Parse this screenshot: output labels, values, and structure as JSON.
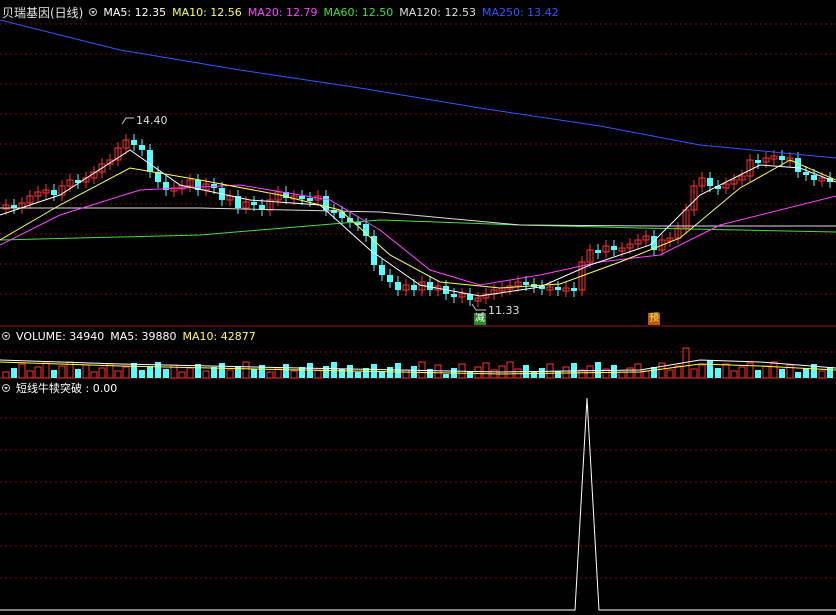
{
  "main_panel": {
    "stock_name": "贝瑞基因(日线)",
    "indicators": [
      {
        "label": "MA5: 12.35",
        "color": "#ffffff"
      },
      {
        "label": "MA10: 12.56",
        "color": "#ffff55"
      },
      {
        "label": "MA20: 12.79",
        "color": "#ff44ff"
      },
      {
        "label": "MA60: 12.50",
        "color": "#44dd44"
      },
      {
        "label": "MA120: 12.53",
        "color": "#dddddd"
      },
      {
        "label": "MA250: 13.42",
        "color": "#3355ff"
      }
    ],
    "annotations": {
      "high": "14.40",
      "low": "11.33"
    },
    "markers": {
      "reduce": "减",
      "forecast": "预"
    }
  },
  "volume_panel": {
    "indicators": [
      {
        "label": "VOLUME: 34940",
        "color": "#ffffff"
      },
      {
        "label": "MA5: 39880",
        "color": "#ffffff"
      },
      {
        "label": "MA10: 42877",
        "color": "#ffff55"
      }
    ]
  },
  "indicator_panel": {
    "label": "短线牛犊突破 : 0.00"
  },
  "colors": {
    "up": "#ff3232",
    "down": "#54ffff",
    "grid": "#6e1010",
    "ma250": "#3355ff"
  }
}
